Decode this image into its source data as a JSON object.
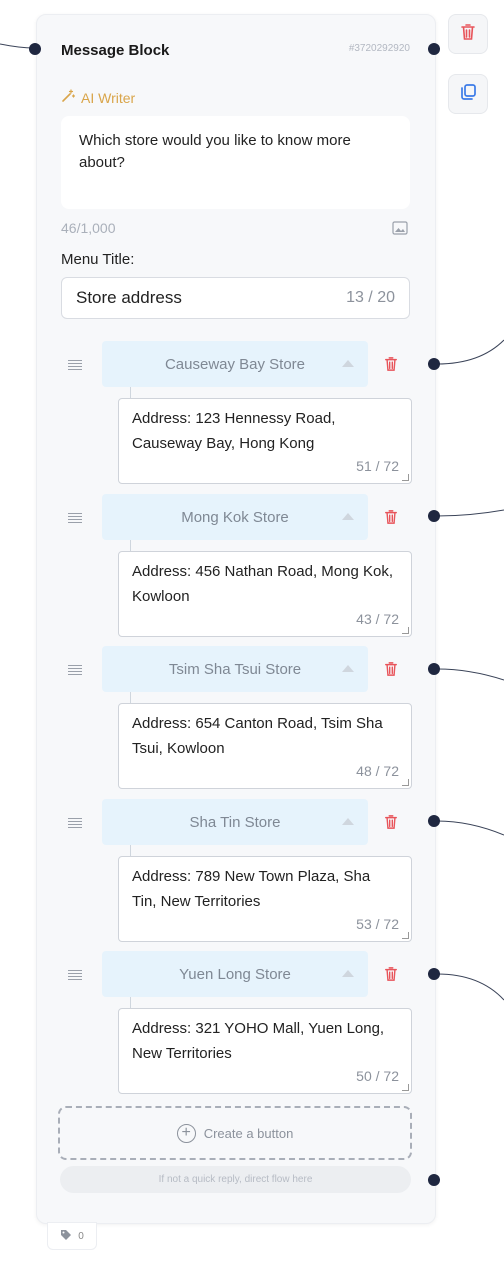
{
  "block": {
    "title": "Message Block",
    "id": "#3720292920",
    "ai_writer_label": "AI Writer",
    "message": "Which store would you like to know more about?",
    "char_count": "46/1,000"
  },
  "menu": {
    "label": "Menu Title:",
    "value": "Store address",
    "count": "13 / 20"
  },
  "buttons": [
    {
      "title": "Causeway Bay Store",
      "address": "Address: 123 Hennessy Road, Causeway Bay, Hong Kong",
      "count": "51 / 72"
    },
    {
      "title": "Mong Kok Store",
      "address": "Address: 456 Nathan Road, Mong Kok, Kowloon",
      "count": "43 / 72"
    },
    {
      "title": "Tsim Sha Tsui Store",
      "address": "Address: 654 Canton Road, Tsim Sha Tsui, Kowloon",
      "count": "48 / 72"
    },
    {
      "title": "Sha Tin Store",
      "address": "Address: 789 New Town Plaza, Sha Tin, New Territories",
      "count": "53 / 72"
    },
    {
      "title": "Yuen Long Store",
      "address": "Address: 321 YOHO Mall, Yuen Long, New Territories",
      "count": "50 / 72"
    }
  ],
  "create_button_label": "Create a button",
  "fallback_label": "If not a quick reply, direct flow here",
  "tag_count": "0",
  "colors": {
    "accent_ai": "#d9a54a",
    "delete": "#e8545a",
    "copy": "#3b7be8",
    "button_head_bg": "#e6f3fc",
    "node_dot": "#1f2740"
  },
  "icons": [
    "trash-icon",
    "copy-icon",
    "magic-wand-icon",
    "image-icon",
    "drag-handle-icon",
    "chevron-up-icon",
    "plus-circle-icon",
    "tag-icon"
  ]
}
